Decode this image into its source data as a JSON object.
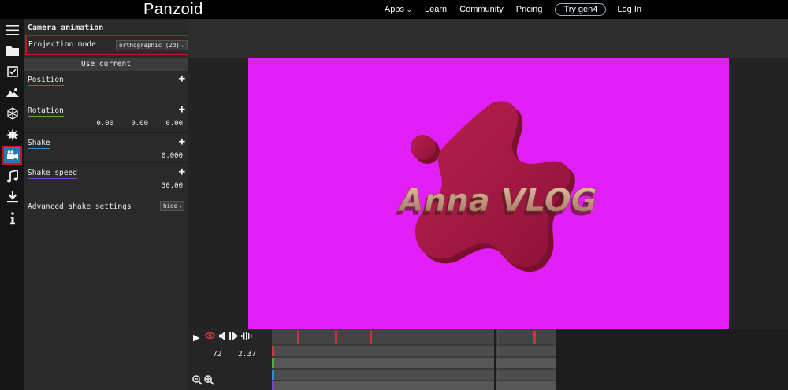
{
  "nav": {
    "logo": "Panzoid",
    "apps": "Apps",
    "learn": "Learn",
    "community": "Community",
    "pricing": "Pricing",
    "gen4": "Try gen4",
    "login": "Log In"
  },
  "iconbar": [
    "menu-icon",
    "folder-icon",
    "checkbox-icon",
    "image-icon",
    "cube-icon",
    "burst-icon",
    "camera-icon",
    "music-icon",
    "download-icon",
    "info-icon"
  ],
  "panel": {
    "title": "Camera animation",
    "projection_label": "Projection mode",
    "projection_value": "orthographic (2d)",
    "use_current": "Use current",
    "position_label": "Position",
    "rotation_label": "Rotation",
    "rotation_values": [
      "0.00",
      "0.00",
      "0.00"
    ],
    "shake_label": "Shake",
    "shake_value": "0.000",
    "shake_speed_label": "Shake speed",
    "shake_speed_value": "30.00",
    "advanced_label": "Advanced shake settings",
    "advanced_value": "hide"
  },
  "preview": {
    "text": "Anna VLOG",
    "background_color": "#e21ff7",
    "shape_color": "#a8154a"
  },
  "timeline": {
    "frame": "72",
    "time": "2.37"
  },
  "colors": {
    "accent_blue": "#2878b8",
    "highlight_red": "#c8141e",
    "position_underline": "#d9344a",
    "rotation_underline": "#5aa83c",
    "shake_underline": "#2e8fd0",
    "shake_speed_underline": "#7a46c8"
  }
}
